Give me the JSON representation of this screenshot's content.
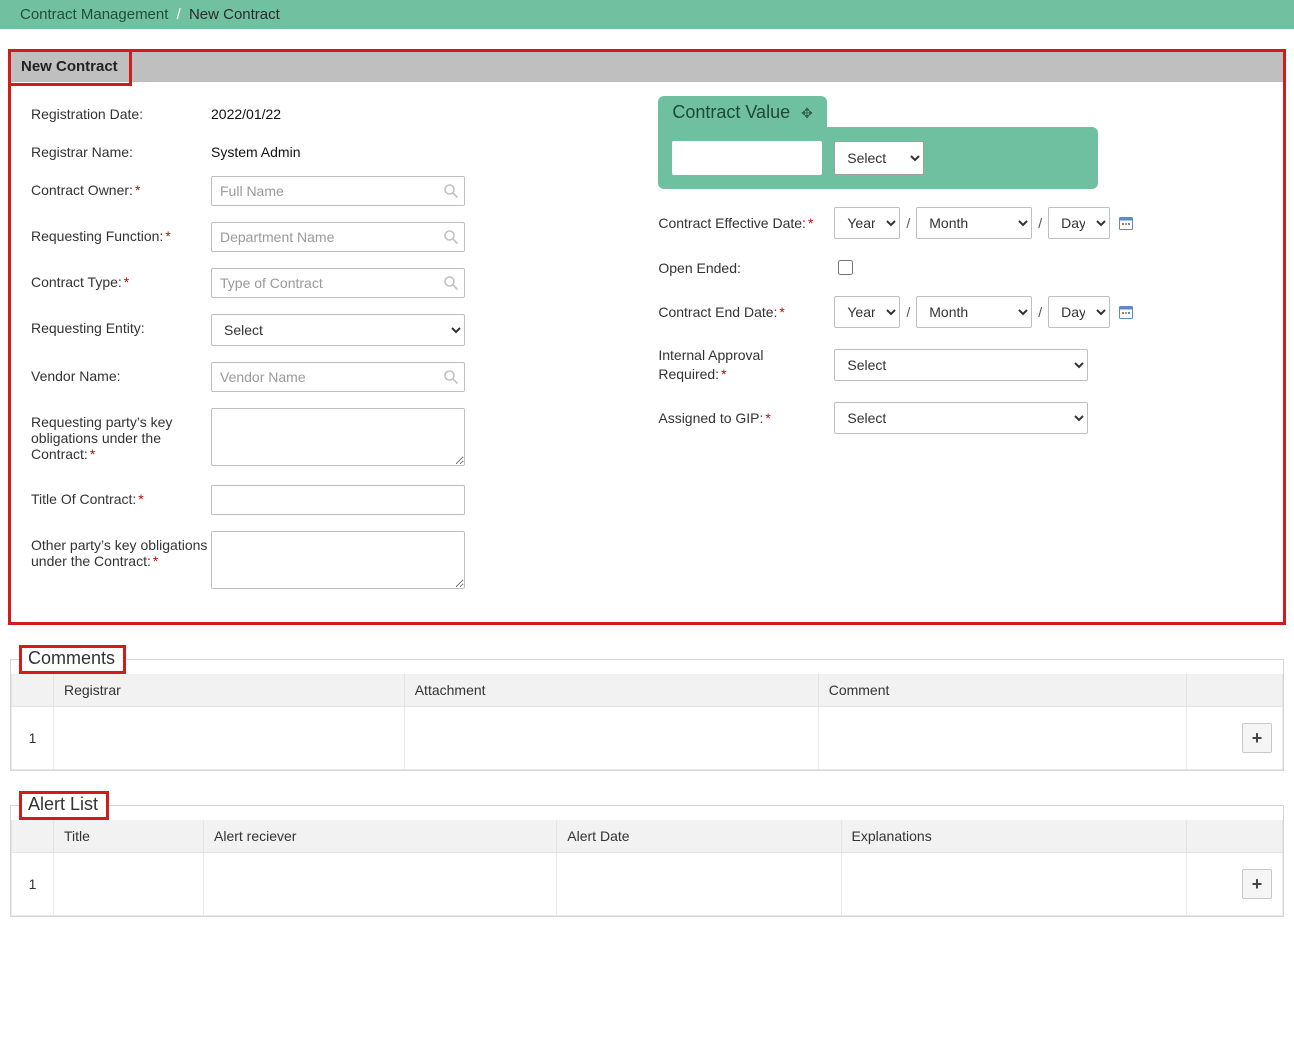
{
  "breadcrumb": {
    "root": "Contract Management",
    "current": "New Contract"
  },
  "panel": {
    "title": "New Contract"
  },
  "left": {
    "registration_date_label": "Registration Date:",
    "registration_date_value": "2022/01/22",
    "registrar_name_label": "Registrar Name:",
    "registrar_name_value": "System Admin",
    "contract_owner_label": "Contract Owner:",
    "contract_owner_placeholder": "Full Name",
    "requesting_function_label": "Requesting Function:",
    "requesting_function_placeholder": "Department Name",
    "contract_type_label": "Contract Type:",
    "contract_type_placeholder": "Type of Contract",
    "requesting_entity_label": "Requesting Entity:",
    "requesting_entity_selected": "Select",
    "vendor_name_label": "Vendor Name:",
    "vendor_name_placeholder": "Vendor Name",
    "req_party_oblig_label": "Requesting party’s key obligations under the Contract:",
    "title_of_contract_label": "Title Of Contract:",
    "other_party_oblig_label": "Other party’s key obligations under the Contract:"
  },
  "right": {
    "contract_value_title": "Contract Value",
    "contract_value_currency_selected": "Select",
    "effective_date_label": "Contract Effective Date:",
    "open_ended_label": "Open Ended:",
    "end_date_label": "Contract End Date:",
    "internal_approval_label": "Internal Approval Required:",
    "internal_approval_selected": "Select",
    "assigned_gip_label": "Assigned to GIP:",
    "assigned_gip_selected": "Select",
    "year_opt": "Year",
    "month_opt": "Month",
    "day_opt": "Day"
  },
  "comments": {
    "legend": "Comments",
    "headers": {
      "registrar": "Registrar",
      "attachment": "Attachment",
      "comment": "Comment"
    },
    "rows": [
      {
        "idx": "1"
      }
    ]
  },
  "alerts": {
    "legend": "Alert List",
    "headers": {
      "title": "Title",
      "receiver": "Alert reciever",
      "date": "Alert Date",
      "explanations": "Explanations"
    },
    "rows": [
      {
        "idx": "1"
      }
    ]
  }
}
